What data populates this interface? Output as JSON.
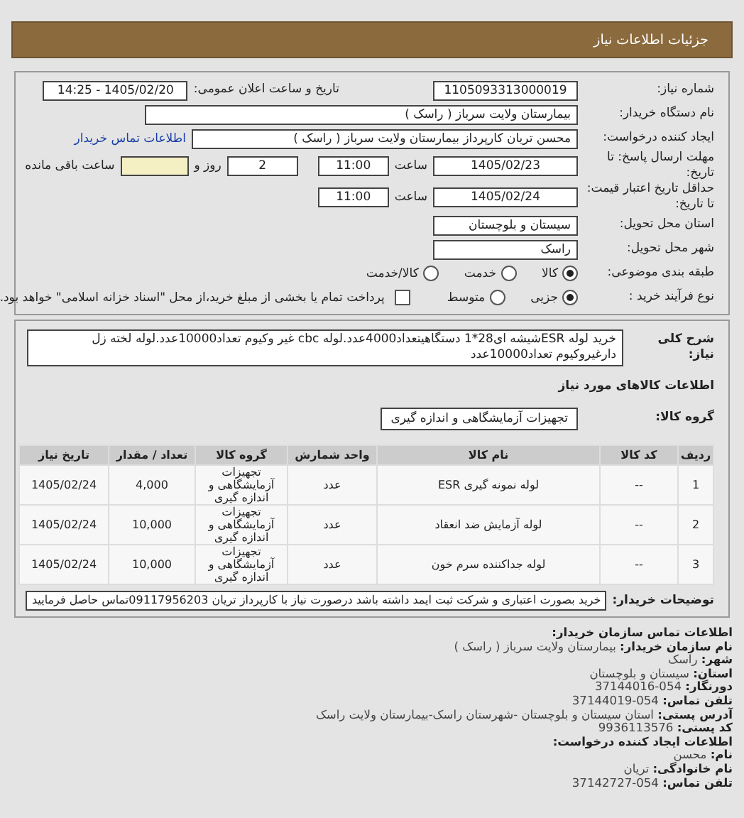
{
  "header": {
    "title": "جزئیات اطلاعات نیاز"
  },
  "details": {
    "need_number": {
      "label": "شماره نیاز:",
      "value": "1105093313000019"
    },
    "announce": {
      "label": "تاریخ و ساعت اعلان عمومی:",
      "value": "1405/02/20 - 14:25"
    },
    "buyer": {
      "label": "نام دستگاه خریدار:",
      "value": "بیمارستان ولایت سرباز ( راسک )"
    },
    "creator": {
      "label": "ایجاد کننده درخواست:",
      "value": "محسن تریان کارپرداز بیمارستان ولایت سرباز ( راسک )",
      "link": "اطلاعات تماس خریدار"
    },
    "deadline": {
      "label": "مهلت ارسال پاسخ: تا تاریخ:",
      "date": "1405/02/23",
      "time_label": "ساعت",
      "time": "11:00",
      "days": "2",
      "days_label": "روز و",
      "remaining_label": "ساعت باقی مانده"
    },
    "validity": {
      "label": "حداقل تاریخ اعتبار قیمت: تا تاریخ:",
      "date": "1405/02/24",
      "time_label": "ساعت",
      "time": "11:00"
    },
    "province": {
      "label": "استان محل تحویل:",
      "value": "سیستان و بلوچستان"
    },
    "city": {
      "label": "شهر محل تحویل:",
      "value": "راسک"
    },
    "category": {
      "label": "طبقه بندی موضوعی:",
      "options": [
        {
          "label": "کالا",
          "selected": true
        },
        {
          "label": "خدمت",
          "selected": false
        },
        {
          "label": "کالا/خدمت",
          "selected": false
        }
      ]
    },
    "process": {
      "label": "نوع فرآیند خرید :",
      "options": [
        {
          "label": "جزیی",
          "selected": true
        },
        {
          "label": "متوسط",
          "selected": false
        }
      ],
      "payment": {
        "checked": false,
        "text": "پرداخت تمام یا بخشی از مبلغ خرید،از محل \"اسناد خزانه اسلامی\" خواهد بود."
      }
    }
  },
  "goods": {
    "description": {
      "label": "شرح کلی نیاز:",
      "value": "خرید لوله ESRشیشه ای28*1 دستگاهیتعداد4000عدد.لوله cbc غیر وکیوم تعداد10000عدد.لوله لخته زل دارغیروکیوم تعداد10000عدد"
    },
    "section_title": "اطلاعات کالاهای مورد نیاز",
    "group": {
      "label": "گروه کالا:",
      "value": "تجهیزات آزمایشگاهی و اندازه گیری"
    },
    "table": {
      "columns": [
        "ردیف",
        "کد کالا",
        "نام کالا",
        "واحد شمارش",
        "گروه کالا",
        "تعداد / مقدار",
        "تاریخ نیاز"
      ],
      "rows": [
        [
          "1",
          "--",
          "لوله نمونه گیری ESR",
          "عدد",
          "تجهیزات آزمایشگاهی و اندازه گیری",
          "4,000",
          "1405/02/24"
        ],
        [
          "2",
          "--",
          "لوله آزمایش ضد انعقاد",
          "عدد",
          "تجهیزات آزمایشگاهی و اندازه گیری",
          "10,000",
          "1405/02/24"
        ],
        [
          "3",
          "--",
          "لوله جداکننده سرم خون",
          "عدد",
          "تجهیزات آزمایشگاهی و اندازه گیری",
          "10,000",
          "1405/02/24"
        ]
      ]
    },
    "notes": {
      "label": "توضیحات خریدار:",
      "value": "خرید بصورت اعتباری و شرکت ثبت ایمد داشته باشد درصورت نیاز با کارپرداز تریان 09117956203تماس حاصل فرمایید"
    }
  },
  "contact": [
    {
      "kind": "heading",
      "label": "اطلاعات تماس سازمان خریدار:"
    },
    {
      "kind": "field",
      "label": "نام سازمان خریدار:",
      "value": "بیمارستان ولایت سرباز ( راسک )"
    },
    {
      "kind": "field",
      "label": "شهر:",
      "value": "راسک"
    },
    {
      "kind": "field",
      "label": "استان:",
      "value": "سیستان و بلوچستان"
    },
    {
      "kind": "field",
      "label": "دورنگار:",
      "value": "054-37144016"
    },
    {
      "kind": "field",
      "label": "تلفن تماس:",
      "value": "054-37144019"
    },
    {
      "kind": "field",
      "label": "آدرس پستی:",
      "value": "استان سیستان و بلوچستان -شهرستان راسک-بیمارستان ولایت راسک"
    },
    {
      "kind": "field",
      "label": "کد پستی:",
      "value": "9936113576"
    },
    {
      "kind": "heading",
      "label": "اطلاعات ایجاد کننده درخواست:"
    },
    {
      "kind": "field",
      "label": "نام:",
      "value": "محسن"
    },
    {
      "kind": "field",
      "label": "نام خانوادگی:",
      "value": "تریان"
    },
    {
      "kind": "field",
      "label": "تلفن تماس:",
      "value": "054-37142727"
    }
  ]
}
